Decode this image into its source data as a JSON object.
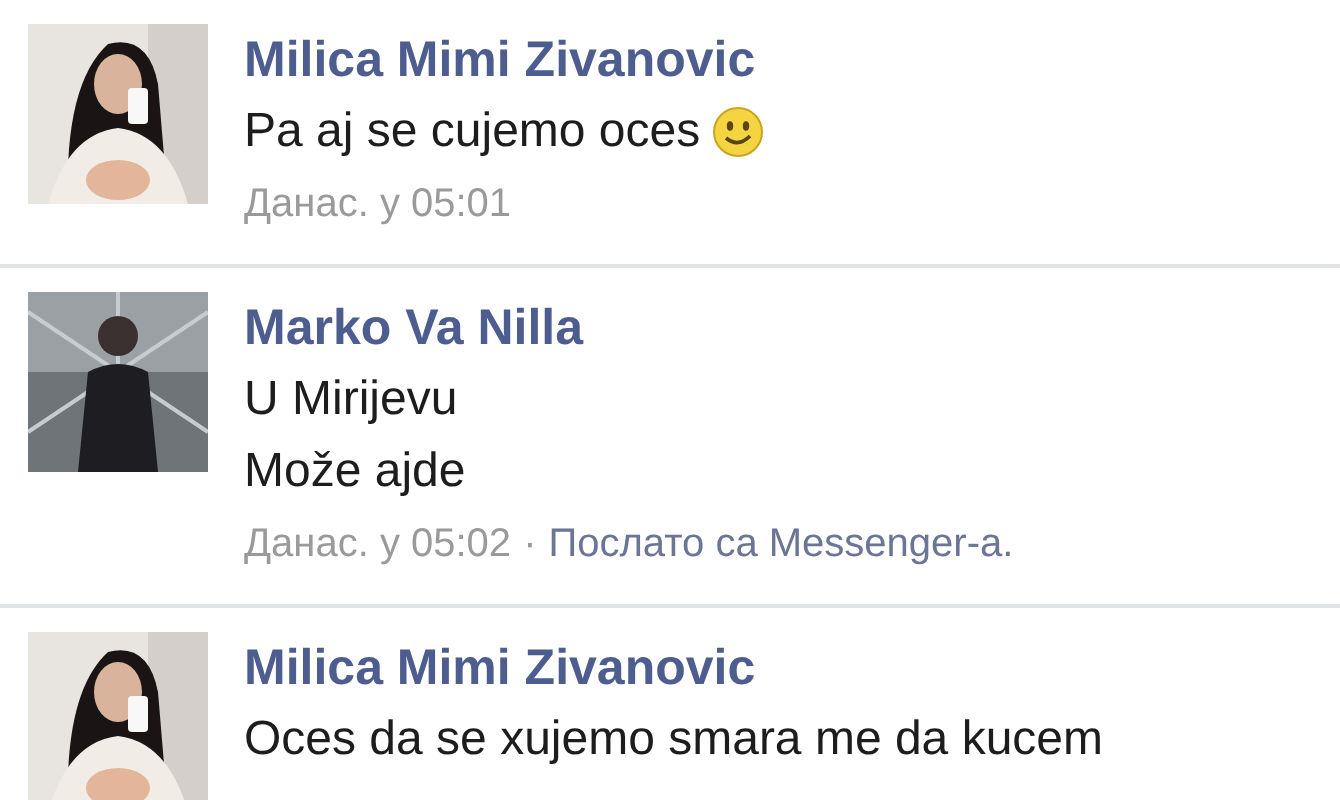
{
  "messages": [
    {
      "sender": "Milica Mimi Zivanovic",
      "avatar": {
        "kind": "picture"
      },
      "lines": [
        "Pa aj se cujemo oces"
      ],
      "smiley": true,
      "time": "Данас. у 05:01"
    },
    {
      "sender": "Marko Va Nilla",
      "avatar": {
        "kind": "picture"
      },
      "lines": [
        "U Mirijevu",
        "Može ajde"
      ],
      "smiley": false,
      "time": "Данас. у 05:02",
      "separator": "·",
      "via": "Послато са Messenger-a."
    },
    {
      "sender": "Milica Mimi Zivanovic",
      "avatar": {
        "kind": "picture"
      },
      "lines": [
        "Oces da se xujemo smara me da kucem"
      ],
      "smiley": false
    }
  ]
}
